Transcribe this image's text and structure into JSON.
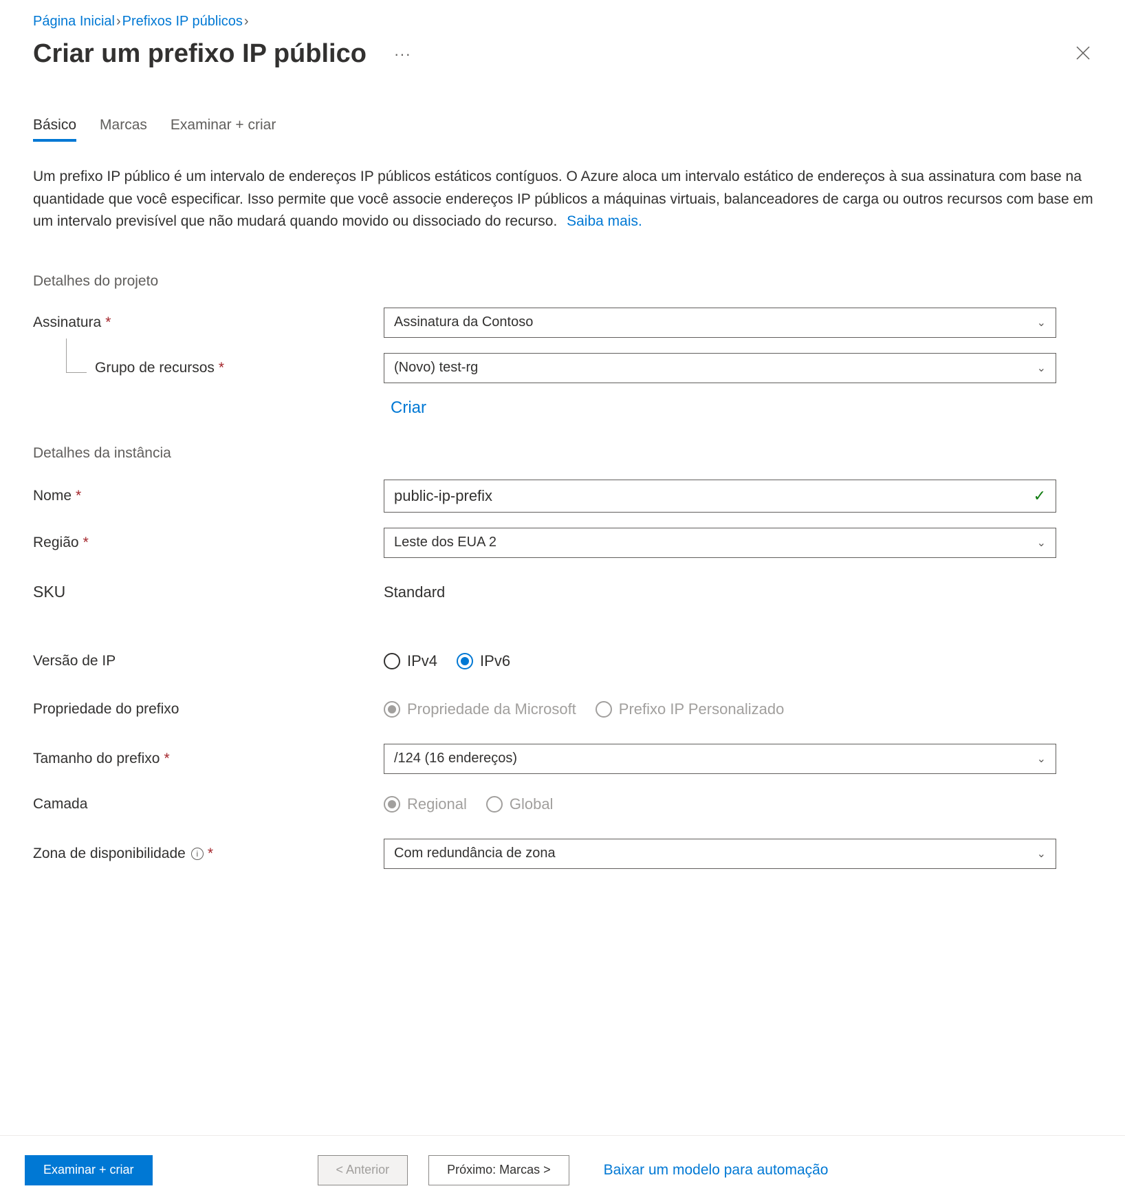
{
  "breadcrumb": {
    "home": "Página Inicial",
    "prefixes": "Prefixos IP públicos"
  },
  "header": {
    "title": "Criar um prefixo IP público",
    "ellipsis": "···"
  },
  "tabs": {
    "basic": "Básico",
    "tags": "Marcas",
    "review": "Examinar + criar"
  },
  "description": "Um prefixo IP público é um intervalo de endereços IP públicos estáticos contíguos. O Azure aloca um intervalo estático de endereços à sua assinatura com base na quantidade que você especificar. Isso permite que você associe endereços IP públicos a máquinas virtuais, balanceadores de carga ou outros recursos com base em um intervalo previsível que não mudará quando movido ou dissociado do recurso.",
  "learn_more": "Saiba mais.",
  "sections": {
    "project": "Detalhes do projeto",
    "instance": "Detalhes da instância"
  },
  "fields": {
    "subscription": {
      "label": "Assinatura",
      "value": "Assinatura da Contoso"
    },
    "resource_group": {
      "label": "Grupo de recursos",
      "value": "(Novo) test-rg",
      "create": "Criar"
    },
    "name": {
      "label": "Nome",
      "value": "public-ip-prefix"
    },
    "region": {
      "label": "Região",
      "value": "Leste dos EUA 2"
    },
    "sku": {
      "label": "SKU",
      "value": "Standard"
    },
    "ip_version": {
      "label": "Versão de IP",
      "opt1": "IPv4",
      "opt2": "IPv6"
    },
    "ownership": {
      "label": "Propriedade do prefixo",
      "opt1": "Propriedade da Microsoft",
      "opt2": "Prefixo IP Personalizado"
    },
    "prefix_size": {
      "label": "Tamanho do prefixo",
      "value": "/124 (16 endereços)"
    },
    "tier": {
      "label": "Camada",
      "opt1": "Regional",
      "opt2": "Global"
    },
    "availability_zone": {
      "label": "Zona de disponibilidade",
      "value": "Com redundância de zona"
    }
  },
  "footer": {
    "review": "Examinar + criar",
    "previous": "< Anterior",
    "next": "Próximo: Marcas >",
    "download": "Baixar um modelo para automação"
  }
}
